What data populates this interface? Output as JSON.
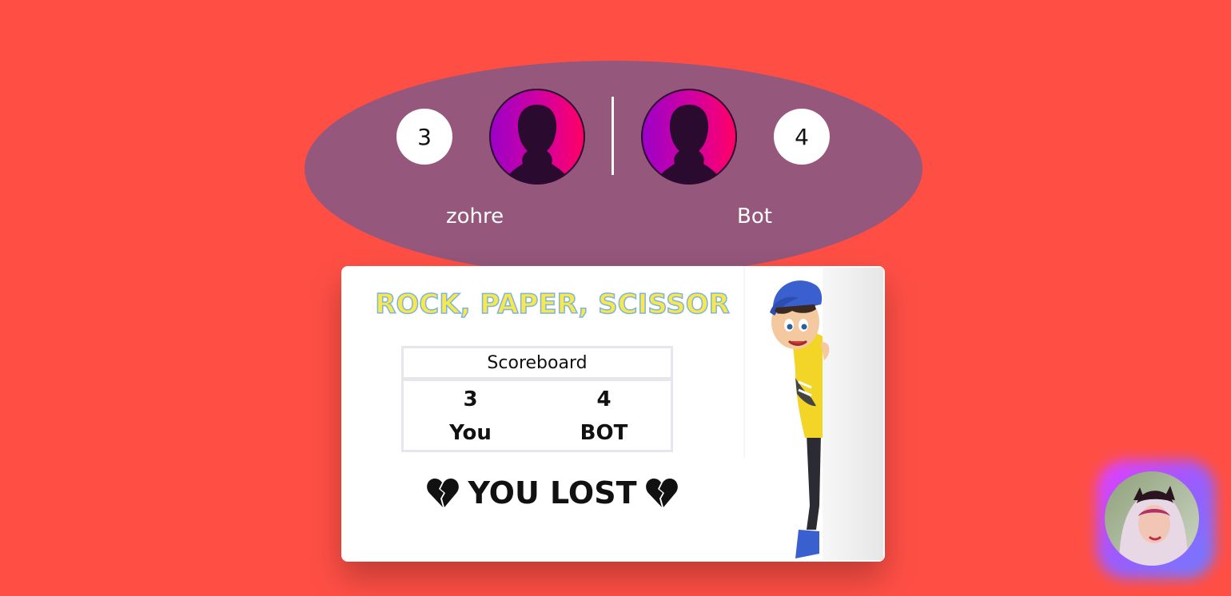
{
  "players": {
    "left": {
      "name": "zohre",
      "score": "3"
    },
    "right": {
      "name": "Bot",
      "score": "4"
    }
  },
  "card": {
    "title": "ROCK, PAPER, SCISSOR",
    "scoreboard": {
      "header": "Scoreboard",
      "you_score": "3",
      "bot_score": "4",
      "you_label": "You",
      "bot_label": "BOT"
    },
    "result": "YOU LOST"
  },
  "colors": {
    "background": "#ff4f45",
    "ellipse": "#95577b",
    "title_fill": "#f7e84b",
    "title_outline": "#7fb3e0"
  },
  "icons": [
    "avatar-silhouette-icon",
    "broken-heart-icon",
    "cartoon-boy-illustration",
    "profile-photo"
  ]
}
